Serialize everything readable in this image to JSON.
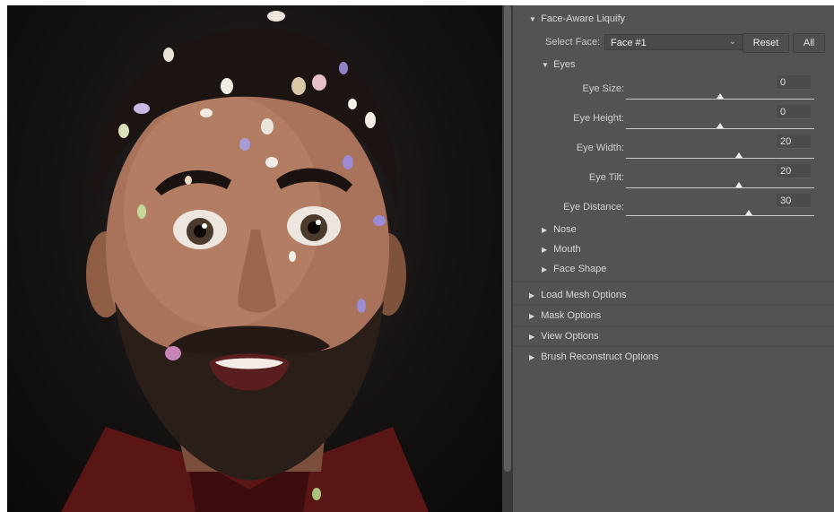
{
  "panel": {
    "face_aware_liquify": "Face-Aware Liquify",
    "select_face_label": "Select Face:",
    "select_face_value": "Face #1",
    "reset_button": "Reset",
    "all_button": "All",
    "eyes_section": "Eyes",
    "eye_controls": [
      {
        "label": "Eye Size:",
        "value": "0",
        "level": 0.5
      },
      {
        "label": "Eye Height:",
        "value": "0",
        "level": 0.5
      },
      {
        "label": "Eye Width:",
        "value": "20",
        "level": 0.6
      },
      {
        "label": "Eye Tilt:",
        "value": "20",
        "level": 0.6
      },
      {
        "label": "Eye Distance:",
        "value": "30",
        "level": 0.65
      }
    ],
    "subsections": [
      "Nose",
      "Mouth",
      "Face Shape"
    ],
    "options": [
      "Load Mesh Options",
      "Mask Options",
      "View Options",
      "Brush Reconstruct Options"
    ]
  },
  "icons": {
    "expanded": "▼",
    "collapsed": "▶",
    "dropdown": "⌄"
  },
  "colors": {
    "panel_bg": "#535353",
    "canvas_bg": "#141111",
    "text": "#d8d8d8"
  }
}
